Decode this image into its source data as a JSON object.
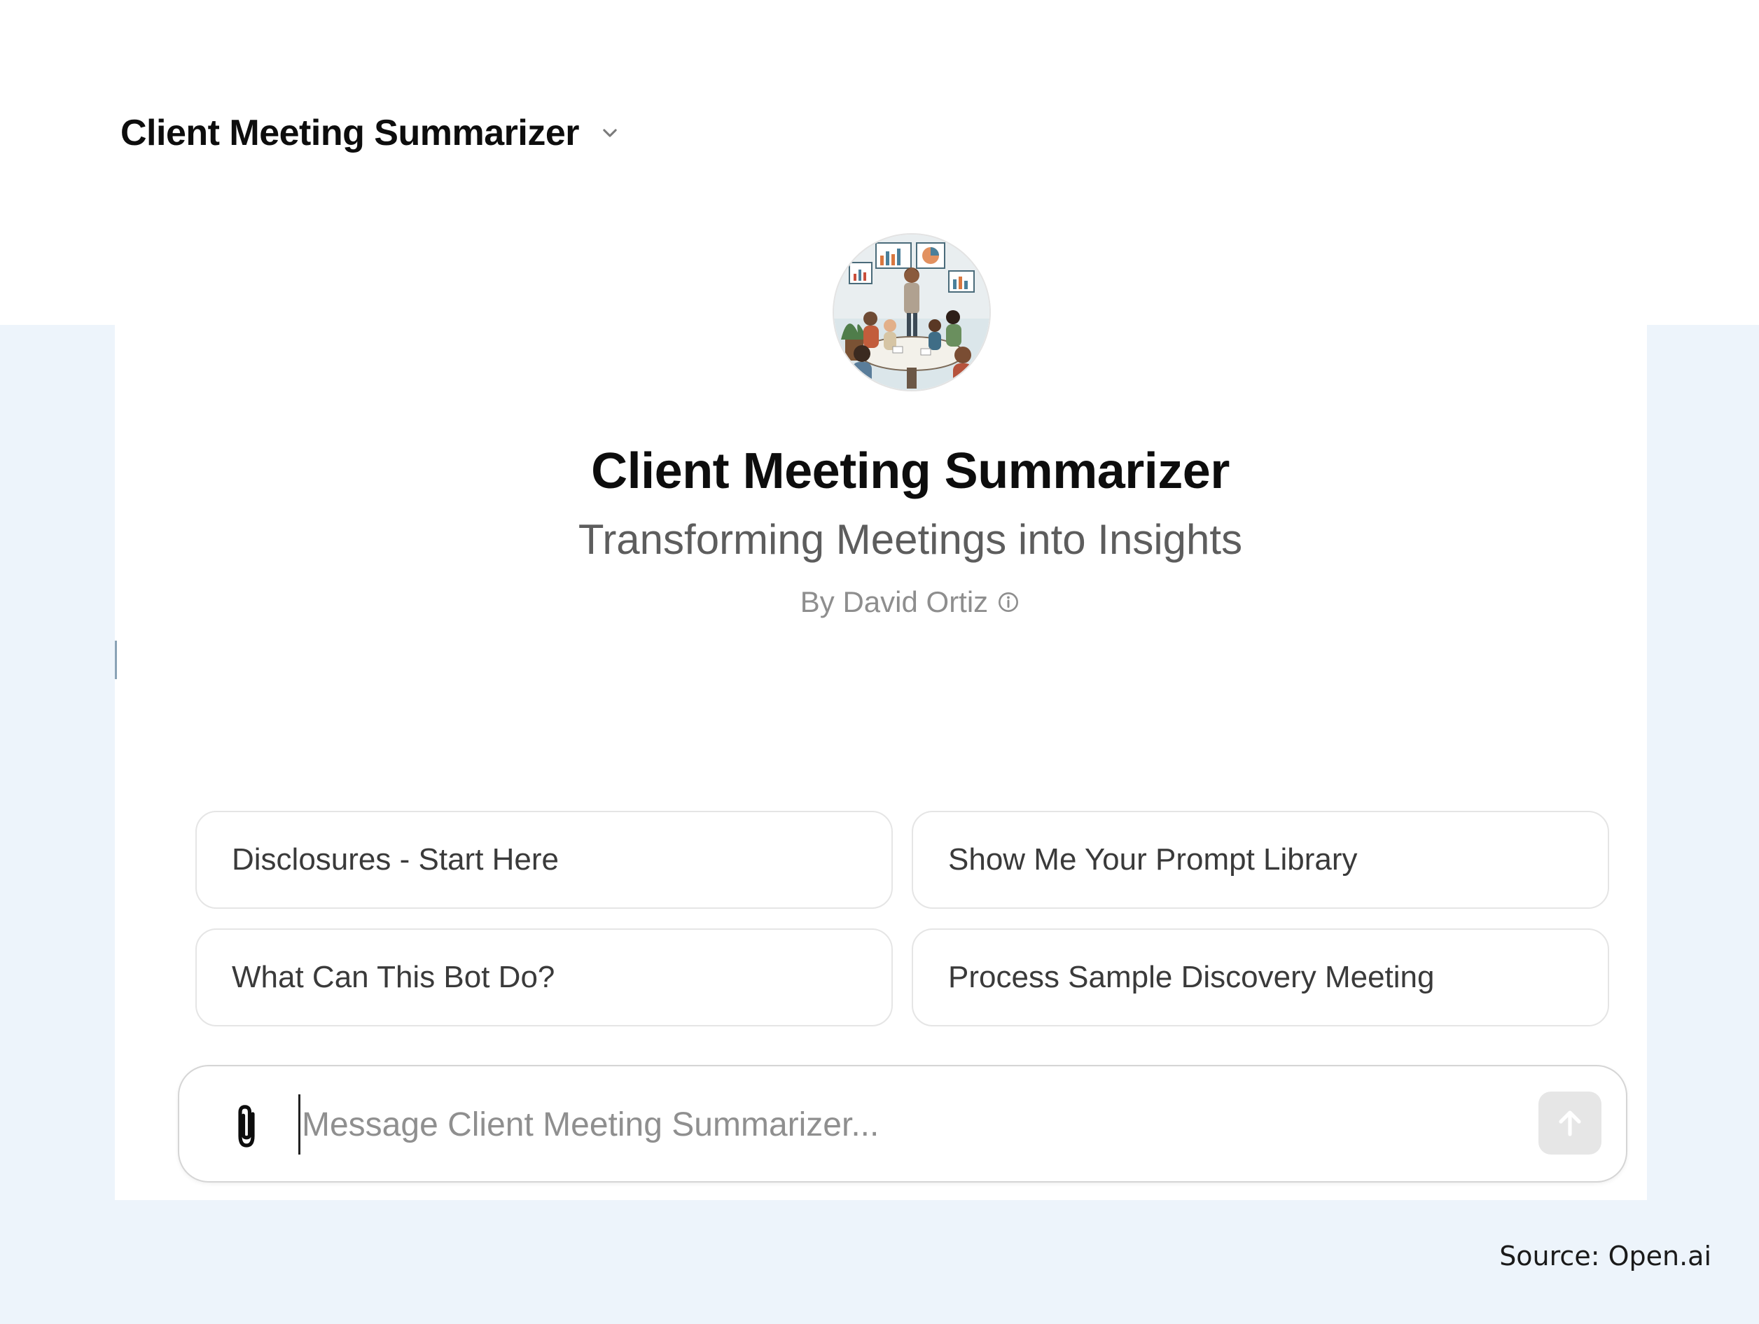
{
  "header": {
    "title": "Client Meeting Summarizer",
    "dropdown_icon": "chevron-down-icon"
  },
  "gpt": {
    "avatar_description": "illustration of a team meeting around a round table",
    "name": "Client Meeting Summarizer",
    "tagline": "Transforming Meetings into Insights",
    "author": "By David Ortiz",
    "author_info_icon": "info-icon"
  },
  "conversation_starters": [
    {
      "label": "Disclosures - Start Here"
    },
    {
      "label": "Show Me Your Prompt Library"
    },
    {
      "label": "What Can This Bot Do?"
    },
    {
      "label": "Process Sample Discovery Meeting"
    }
  ],
  "composer": {
    "placeholder": "Message Client Meeting Summarizer...",
    "value": "",
    "attach_icon": "paperclip-icon",
    "send_icon": "arrow-up-icon"
  },
  "footer": {
    "source": "Source: Open.ai"
  },
  "colors": {
    "page_background": "#edf4fb",
    "panel_background": "#ffffff",
    "send_button_disabled": "#e6e6e6",
    "primary_text": "#0d0d0d",
    "secondary_text": "#5d5d5d"
  }
}
